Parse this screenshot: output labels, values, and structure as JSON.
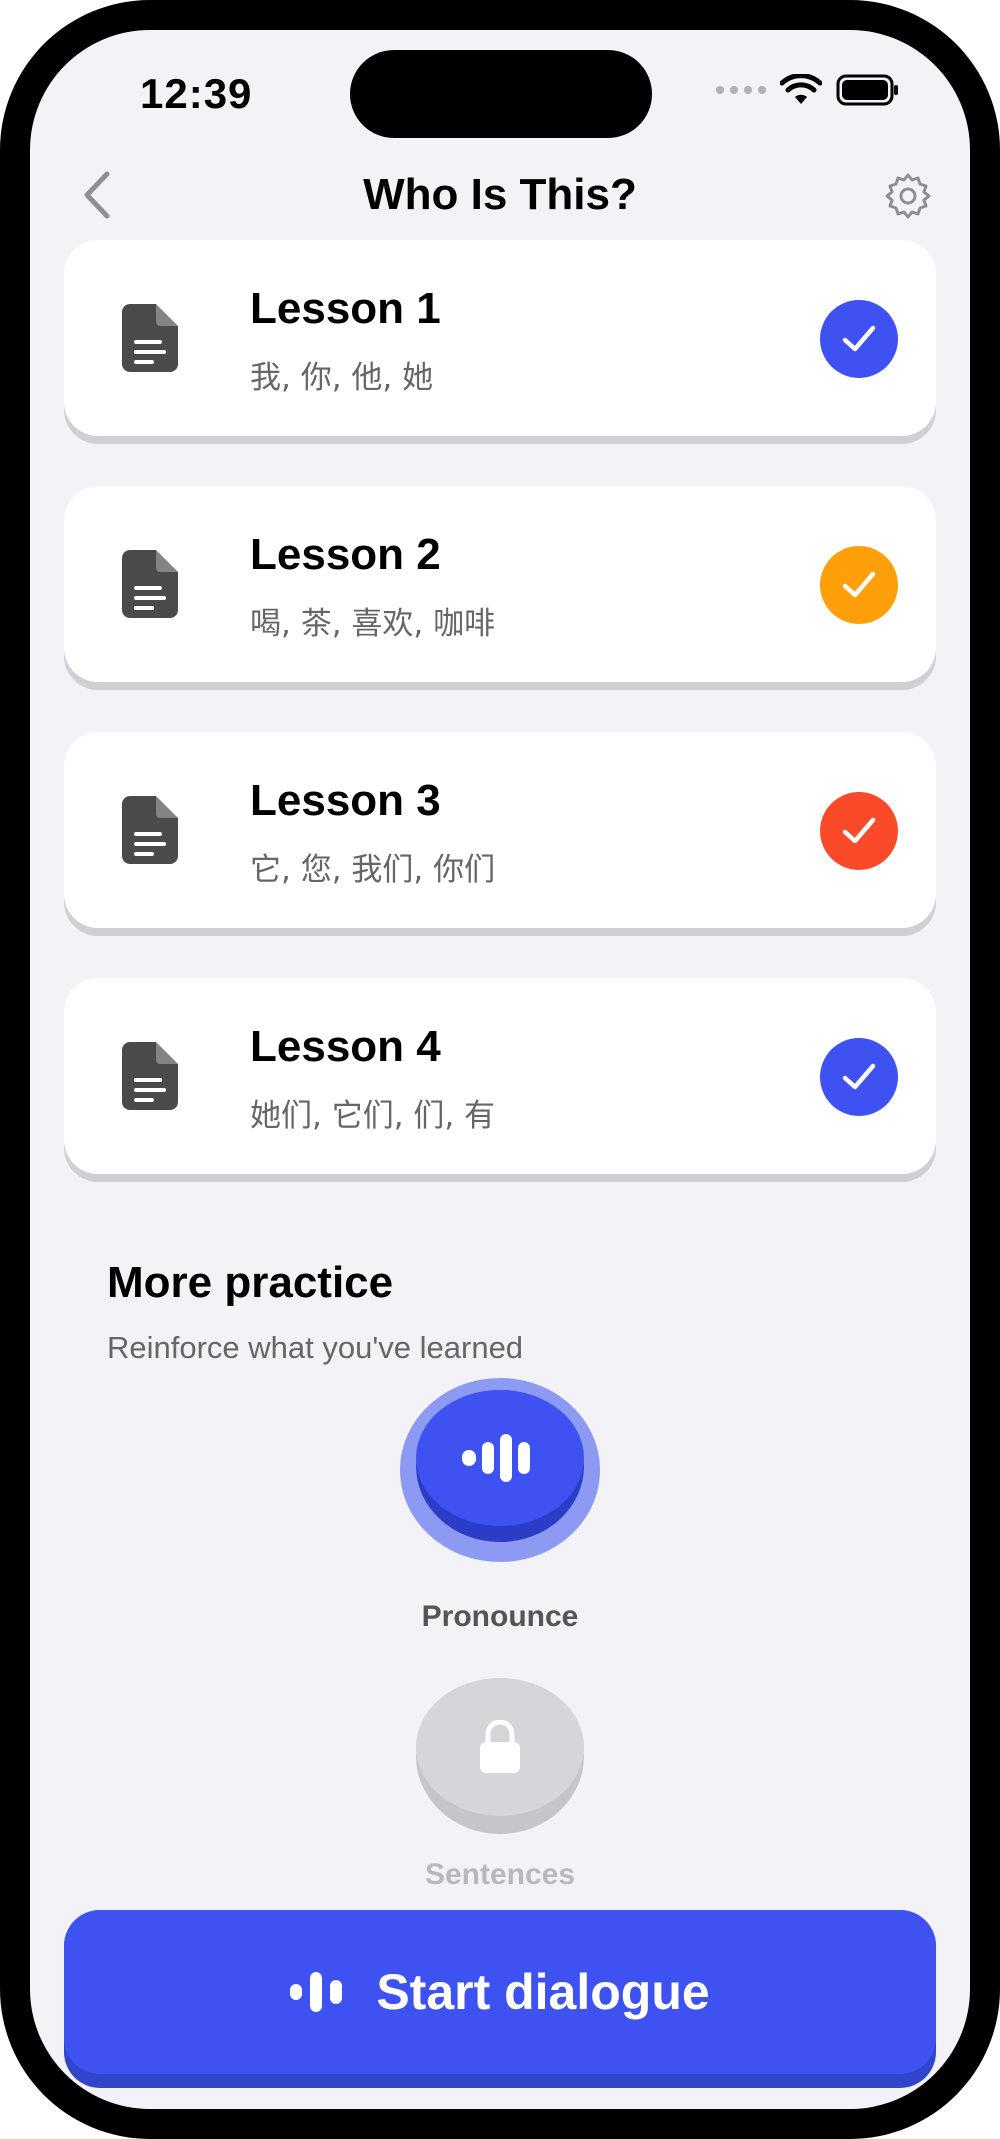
{
  "status": {
    "time": "12:39"
  },
  "nav": {
    "title": "Who Is This?"
  },
  "lessons": [
    {
      "title": "Lesson 1",
      "words": "我, 你, 他, 她",
      "status_color": "#3d52f0"
    },
    {
      "title": "Lesson 2",
      "words": "喝, 茶, 喜欢, 咖啡",
      "status_color": "#ff9f0a"
    },
    {
      "title": "Lesson 3",
      "words": "它, 您, 我们, 你们",
      "status_color": "#fa4a2a"
    },
    {
      "title": "Lesson 4",
      "words": "她们, 它们, 们, 有",
      "status_color": "#3d52f0"
    }
  ],
  "more": {
    "title": "More practice",
    "subtitle": "Reinforce what you've learned",
    "pronounce_label": "Pronounce",
    "sentences_label": "Sentences"
  },
  "cta": {
    "label": "Start dialogue"
  },
  "icons": {
    "back": "chevron-left-icon",
    "settings": "gear-icon",
    "lesson": "document-icon",
    "check": "checkmark-icon",
    "voice": "waveform-icon",
    "lock": "lock-icon"
  },
  "colors": {
    "accent": "#3d52f0",
    "background": "#f2f2f7"
  }
}
